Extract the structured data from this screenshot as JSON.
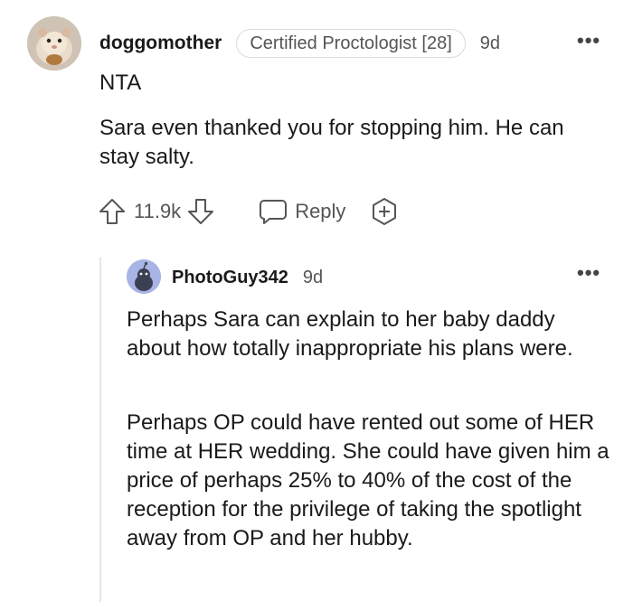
{
  "comment": {
    "username": "doggomother",
    "flair": "Certified Proctologist [28]",
    "time": "9d",
    "more_label": "•••",
    "paragraphs": [
      "NTA",
      "Sara even thanked you for stopping him. He can stay salty."
    ],
    "score": "11.9k",
    "reply_label": "Reply",
    "icons": [
      "avatar-hamster",
      "upvote-arrow-icon",
      "downvote-arrow-icon",
      "chat-bubble-icon",
      "award-plus-icon",
      "more-dots-icon"
    ]
  },
  "reply": {
    "username": "PhotoGuy342",
    "time": "9d",
    "more_label": "•••",
    "paragraphs": [
      "Perhaps Sara can explain to her baby daddy about how totally inappropriate his plans were.",
      "Perhaps OP could have rented out some of HER time at HER wedding. She could have given him a price of perhaps 25% to 40% of the cost of the reception for the privilege of taking the spotlight away from OP and her hubby."
    ]
  },
  "colors": {
    "text": "#1a1a1b",
    "muted": "#555555",
    "border": "#d7dadc",
    "thread_line": "#e6e6e6",
    "reply_avatar_bg": "#a8b4e6"
  }
}
